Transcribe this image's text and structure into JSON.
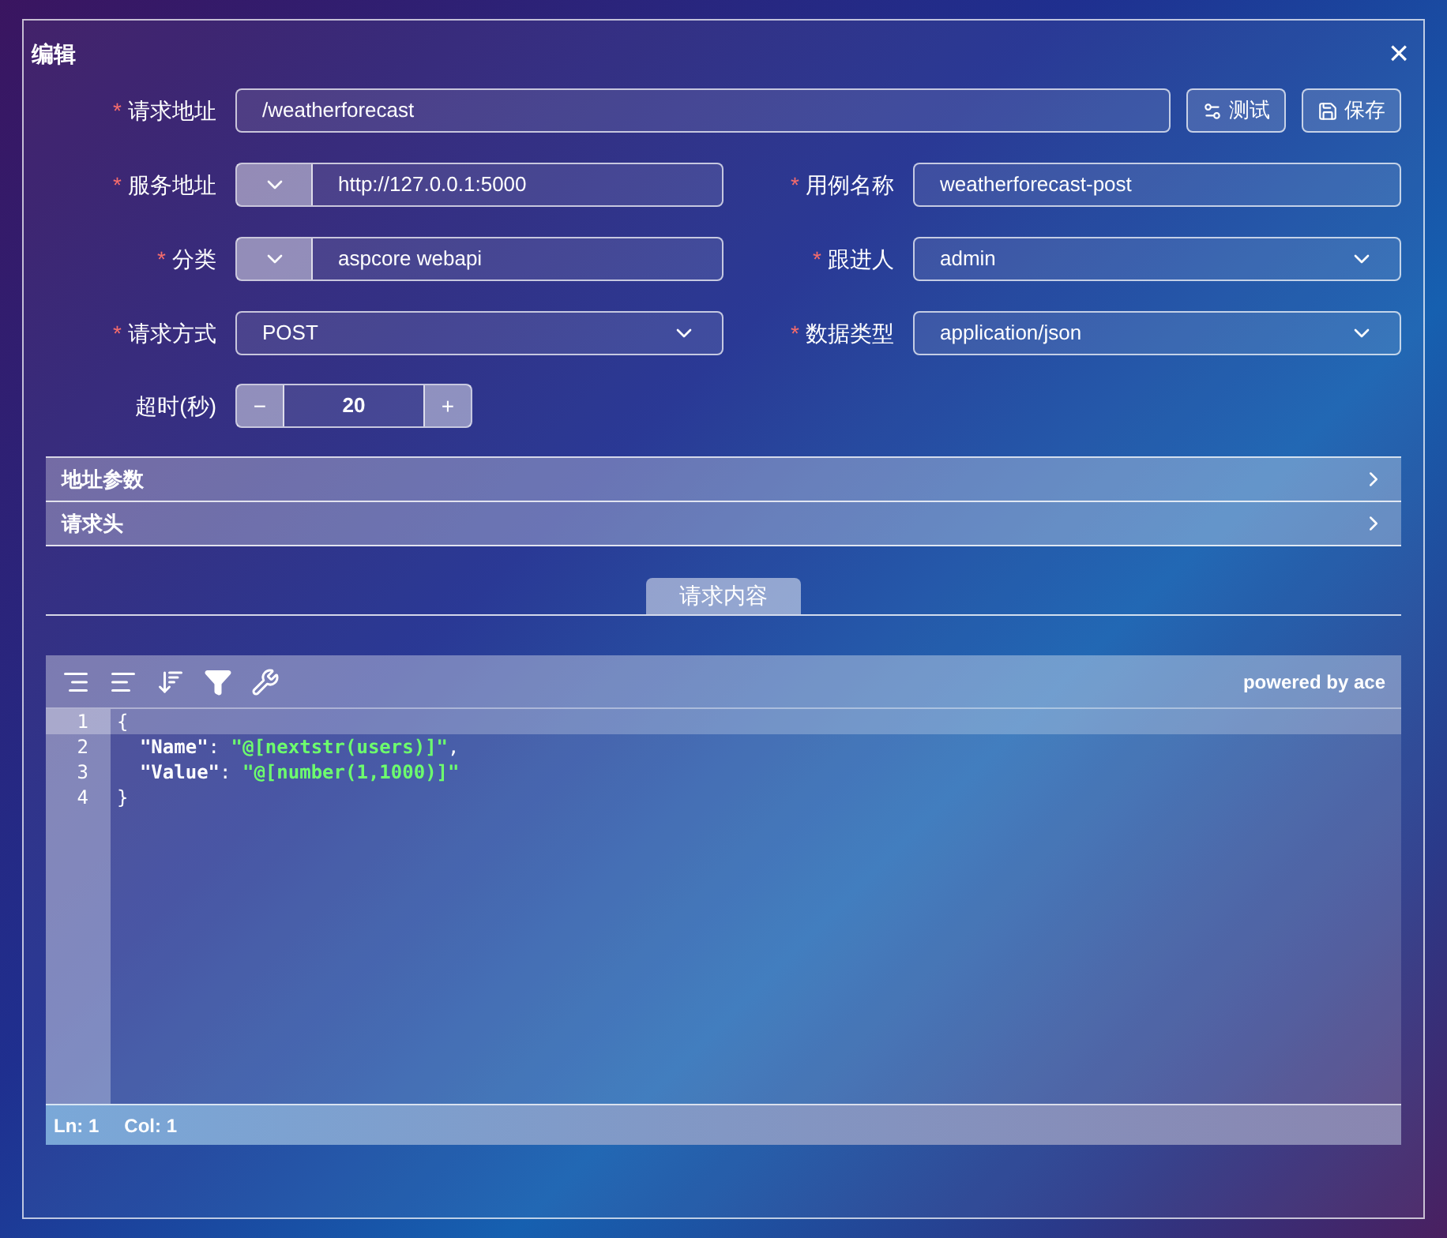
{
  "dialog": {
    "title": "编辑",
    "close": "×"
  },
  "url_row": {
    "label": "请求地址",
    "required_mark": "*",
    "value": "/weatherforecast",
    "buttons": [
      "测试",
      "保存"
    ]
  },
  "fields": [
    {
      "kind": "prefixed",
      "label": "服务地址",
      "required_mark": "*",
      "value": "http://127.0.0.1:5000"
    },
    {
      "kind": "text",
      "label": "用例名称",
      "required_mark": "*",
      "value": "weatherforecast-post"
    },
    {
      "kind": "prefixed",
      "label": "分类",
      "required_mark": "*",
      "value": "aspcore webapi"
    },
    {
      "kind": "select",
      "label": "跟进人",
      "required_mark": "*",
      "value": "admin"
    },
    {
      "kind": "select",
      "label": "请求方式",
      "required_mark": "*",
      "value": "POST"
    },
    {
      "kind": "select",
      "label": "数据类型",
      "required_mark": "*",
      "value": "application/json"
    }
  ],
  "timeout": {
    "label": "超时(秒)",
    "minus": "−",
    "value": "20",
    "plus": "+"
  },
  "sections": [
    {
      "title": "地址参数",
      "expanded": false
    },
    {
      "title": "请求头",
      "expanded": false
    }
  ],
  "body_tab": "请求内容",
  "editor": {
    "powered_by": "powered by ace",
    "lines": [
      [
        {
          "kind": "punct",
          "text": "{"
        }
      ],
      [
        {
          "kind": "key",
          "text": "  \"Name\""
        },
        {
          "kind": "punct",
          "text": ": "
        },
        {
          "kind": "string",
          "text": "\"@[nextstr(users)]\""
        },
        {
          "kind": "punct",
          "text": ","
        }
      ],
      [
        {
          "kind": "key",
          "text": "  \"Value\""
        },
        {
          "kind": "punct",
          "text": ": "
        },
        {
          "kind": "string",
          "text": "\"@[number(1,1000)]\""
        }
      ],
      [
        {
          "kind": "punct",
          "text": "}"
        }
      ]
    ],
    "line_numbers": [
      {
        "text": "1",
        "active": true
      },
      {
        "text": "2",
        "active": false
      },
      {
        "text": "3",
        "active": false
      },
      {
        "text": "4",
        "active": false
      }
    ],
    "status": [
      "Ln: 1",
      "Col: 1"
    ]
  }
}
